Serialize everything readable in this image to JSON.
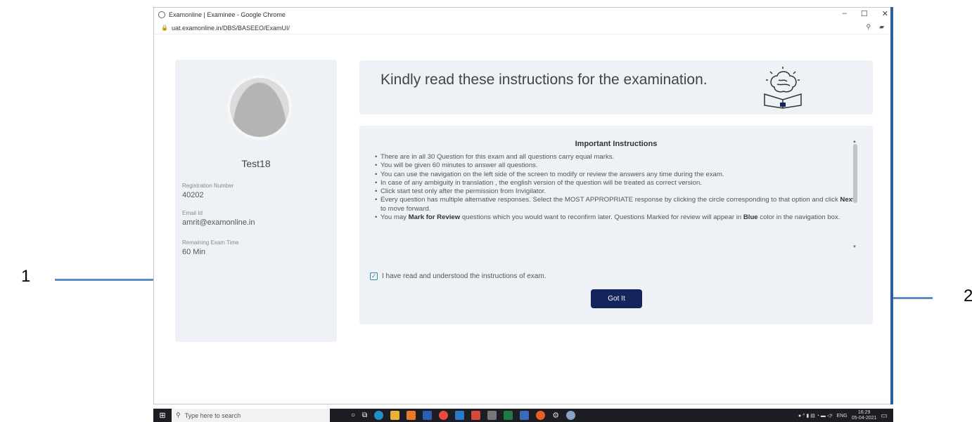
{
  "annotations": {
    "left_number": "1",
    "right_number": "2"
  },
  "window": {
    "title": "Examonline | Examinee - Google Chrome",
    "url": "uat.examonline.in/DBS/BASEEO/ExamUI/",
    "controls": {
      "minimize": "–",
      "maximize": "☐",
      "close": "✕"
    }
  },
  "profile": {
    "name": "Test18",
    "registration_label": "Registration Number",
    "registration_value": "40202",
    "email_label": "Email Id",
    "email_value": "amrit@examonline.in",
    "time_label": "Remaining Exam Time",
    "time_value": "60 Min"
  },
  "header": {
    "title": "Kindly read these instructions for the examination."
  },
  "instructions": {
    "title": "Important Instructions",
    "items": [
      "There are in all 30 Question for this exam and all questions carry equal marks.",
      "You will be given 60 minutes to answer all questions.",
      "You can use the navigation on the left side of the screen to modify or review the  answers any time during the exam.",
      "In case of any ambiguity in translation , the english version of the question will be treated as correct version.",
      "Click start test only after the permission from Invigilator.",
      "Every question has multiple alternative responses. Select the MOST APPROPRIATE response by clicking the circle corresponding to that option and click Next to move forward.",
      "You may Mark for Review questions which you would want to reconfirm later. Questions Marked for review will appear in Blue color in the navigation box."
    ],
    "checkbox_label": "I have read and understood the instructions of exam.",
    "checkbox_checked": true,
    "button_label": "Got It"
  },
  "taskbar": {
    "search_placeholder": "Type here to search",
    "lang": "ENG",
    "time": "16:29",
    "date": "05-04-2021"
  },
  "colors": {
    "button": "#14245c",
    "panel": "#eef1f5",
    "arrow": "#5b8ec9"
  }
}
